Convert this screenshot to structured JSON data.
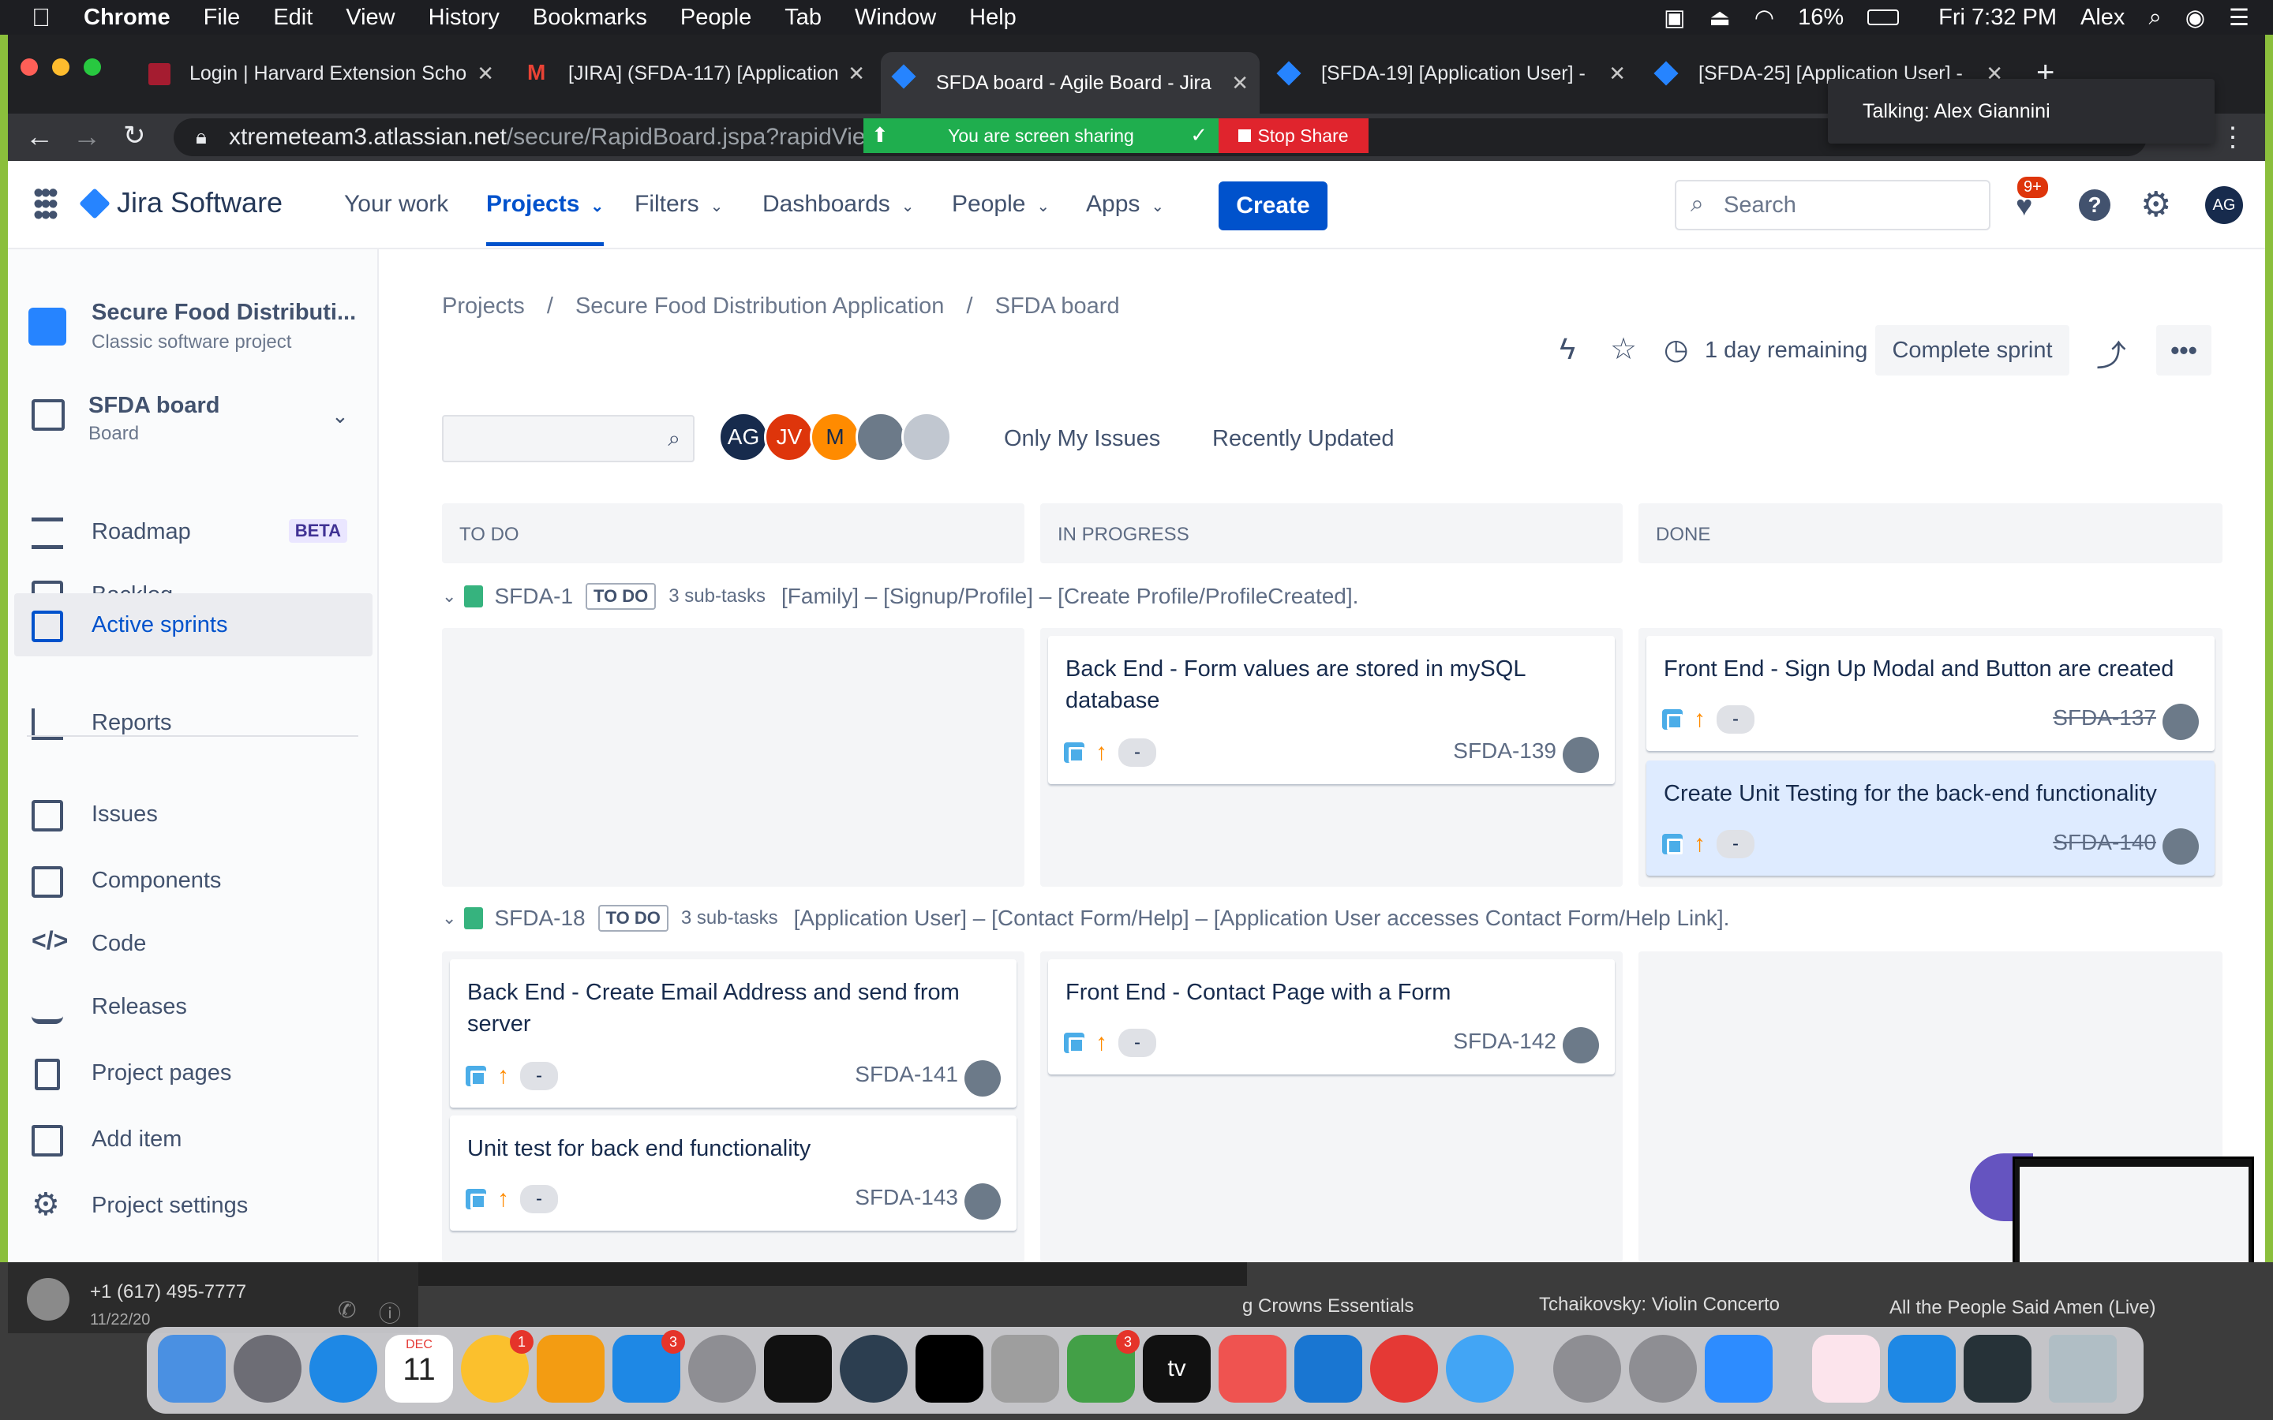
{
  "menubar": {
    "app": "Chrome",
    "items": [
      "File",
      "Edit",
      "View",
      "History",
      "Bookmarks",
      "People",
      "Tab",
      "Window",
      "Help"
    ],
    "battery": "16%",
    "clock": "Fri 7:32 PM",
    "user": "Alex"
  },
  "browser": {
    "tabs": [
      {
        "title": "Login | Harvard Extension Scho"
      },
      {
        "title": "[JIRA] (SFDA-117) [Application"
      },
      {
        "title": "SFDA board - Agile Board - Jira"
      },
      {
        "title": "[SFDA-19] [Application User] -"
      },
      {
        "title": "[SFDA-25] [Application User] -"
      }
    ],
    "url_host": "xtremeteam3.atlassian.net",
    "url_path": "/secure/RapidBoard.jspa?rapidView",
    "share_text": "You are screen sharing",
    "stop_share": "Stop Share",
    "talking": "Talking: Alex Giannini"
  },
  "jira": {
    "logo": "Jira Software",
    "nav": [
      "Your work",
      "Projects",
      "Filters",
      "Dashboards",
      "People",
      "Apps"
    ],
    "create": "Create",
    "search_placeholder": "Search",
    "notif_badge": "9+",
    "user_initials": "AG"
  },
  "sidebar": {
    "project_name": "Secure Food Distributi...",
    "project_type": "Classic software project",
    "board_name": "SFDA board",
    "board_type": "Board",
    "items": [
      {
        "label": "Roadmap",
        "badge": "BETA"
      },
      {
        "label": "Backlog"
      },
      {
        "label": "Active sprints"
      },
      {
        "label": "Reports"
      },
      {
        "label": "Issues"
      },
      {
        "label": "Components"
      },
      {
        "label": "Code"
      },
      {
        "label": "Releases"
      },
      {
        "label": "Project pages"
      },
      {
        "label": "Add item"
      },
      {
        "label": "Project settings"
      }
    ]
  },
  "board": {
    "breadcrumb": [
      "Projects",
      "Secure Food Distribution Application",
      "SFDA board"
    ],
    "sprint_remaining": "1 day remaining",
    "complete_sprint": "Complete sprint",
    "filters": [
      "Only My Issues",
      "Recently Updated"
    ],
    "avatars": [
      "AG",
      "JV",
      "M"
    ],
    "columns": [
      "TO DO",
      "IN PROGRESS",
      "DONE"
    ],
    "swimlanes": [
      {
        "key": "SFDA-1",
        "status": "TO DO",
        "subtasks": "3 sub-tasks",
        "summary": "[Family] – [Signup/Profile] – [Create Profile/ProfileCreated].",
        "cards": [
          {
            "title": "Back End - Form values are stored in mySQL database",
            "key": "SFDA-139",
            "est": "-"
          },
          {
            "title": "Front End - Sign Up Modal and Button are created",
            "key": "SFDA-137",
            "est": "-"
          },
          {
            "title": "Create Unit Testing for the back-end functionality",
            "key": "SFDA-140",
            "est": "-"
          }
        ]
      },
      {
        "key": "SFDA-18",
        "status": "TO DO",
        "subtasks": "3 sub-tasks",
        "summary": "[Application User] – [Contact Form/Help] – [Application User accesses Contact Form/Help Link].",
        "cards": [
          {
            "title": "Back End - Create Email Address and send from server",
            "key": "SFDA-141",
            "est": "-"
          },
          {
            "title": "Unit test for back end functionality",
            "key": "SFDA-143",
            "est": "-"
          },
          {
            "title": "Front End - Contact Page with a Form",
            "key": "SFDA-142",
            "est": "-"
          }
        ]
      }
    ]
  },
  "background_apps": {
    "phone_number": "+1 (617) 495-7777",
    "phone_date": "11/22/20",
    "music1": "g Crowns Essentials",
    "music2": "Tchaikovsky: Violin Concerto",
    "music3": "All the People Said Amen (Live)"
  },
  "dock": {
    "calendar_month": "DEC",
    "calendar_day": "11",
    "badges": [
      "1",
      "3",
      "3"
    ],
    "tv_label": "tv"
  }
}
